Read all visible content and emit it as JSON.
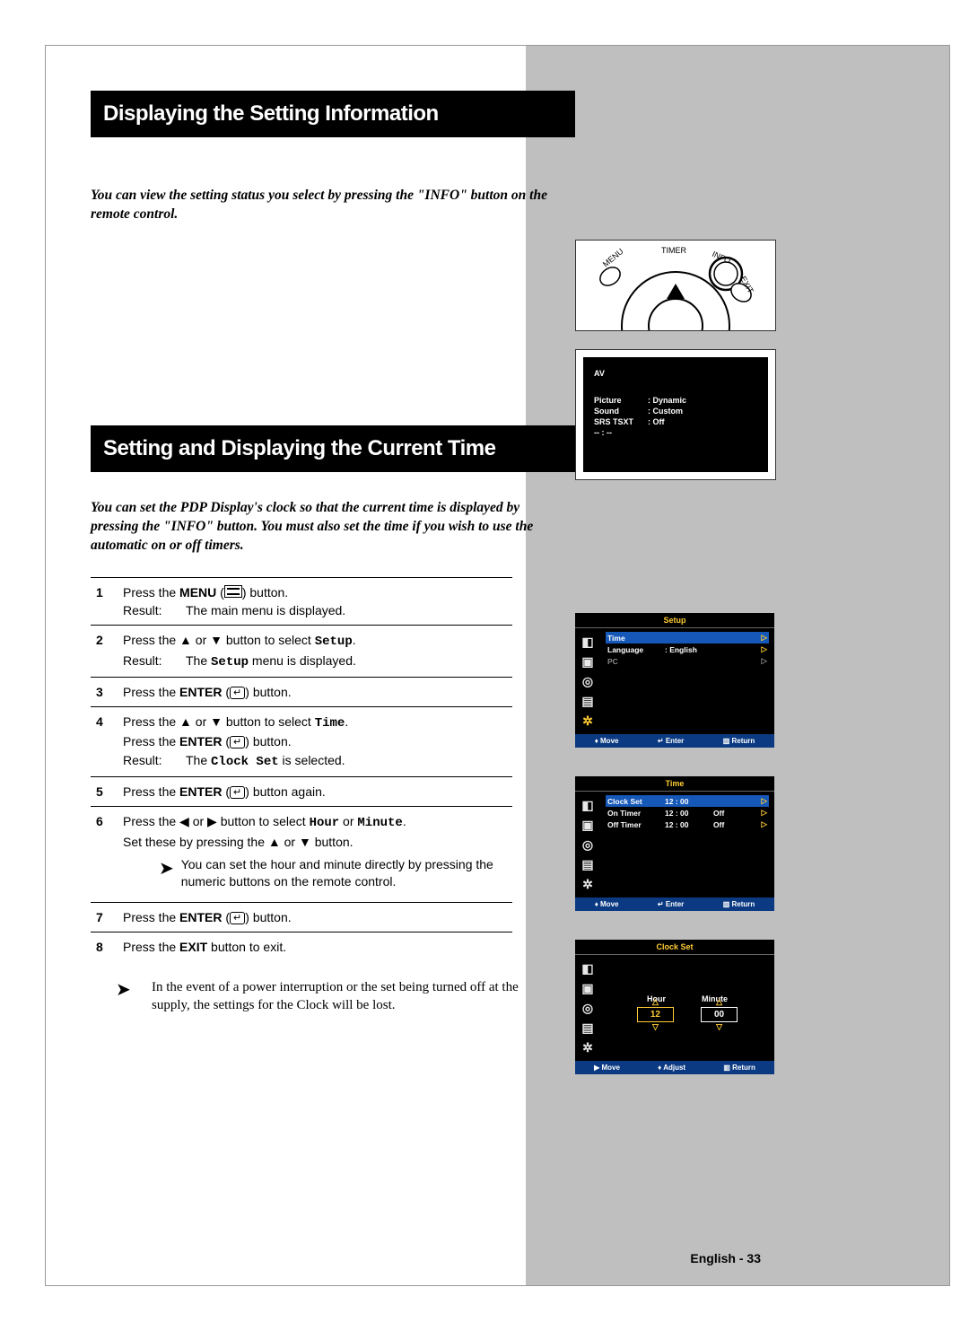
{
  "section1": {
    "title": "Displaying the Setting Information",
    "intro": "You can view the setting status you select by pressing the \"INFO\" button on the remote control."
  },
  "section2": {
    "title": "Setting and Displaying the Current Time",
    "intro": "You can set the PDP Display's clock so that the current time is displayed by pressing the \"INFO\" button. You must also set the time if you wish to use the automatic on or off timers."
  },
  "steps": {
    "1": {
      "num": "1",
      "a": "Press the ",
      "b": "MENU",
      "c": " (",
      "d": ") button.",
      "r": "Result:",
      "res": "The main menu is displayed."
    },
    "2": {
      "num": "2",
      "a": "Press the ",
      "b": " or ",
      "c": " button to select ",
      "d": "Setup",
      "e": ".",
      "r": "Result:",
      "res1": "The ",
      "res2": "Setup",
      "res3": " menu is displayed."
    },
    "3": {
      "num": "3",
      "a": "Press the ",
      "b": "ENTER",
      "c": " (",
      "d": ") button."
    },
    "4": {
      "num": "4",
      "a": "Press the ",
      "b": " or ",
      "c": " button to select ",
      "d": "Time",
      "e": ".",
      "f": "Press the ",
      "g": "ENTER",
      "h": " (",
      "i": ") button.",
      "r": "Result:",
      "res1": "The ",
      "res2": "Clock Set",
      "res3": " is selected."
    },
    "5": {
      "num": "5",
      "a": "Press the ",
      "b": "ENTER",
      "c": " (",
      "d": ") button again."
    },
    "6": {
      "num": "6",
      "a": "Press the ",
      "b": " or ",
      "c": " button to select ",
      "d": "Hour",
      "e": " or ",
      "f": "Minute",
      "g": ".",
      "h": "Set these by pressing the ",
      "i": " or ",
      "j": " button.",
      "note": "You can set the hour and minute directly by pressing the numeric buttons on the remote control."
    },
    "7": {
      "num": "7",
      "a": "Press the ",
      "b": "ENTER",
      "c": " (",
      "d": ") button."
    },
    "8": {
      "num": "8",
      "a": "Press the ",
      "b": "EXIT",
      "c": " button to exit."
    }
  },
  "footnote": "In the event of a power interruption or the set being turned off at the supply, the settings for the Clock will be lost.",
  "remote": {
    "menu": "MENU",
    "timer": "TIMER",
    "info": "INFO",
    "exit": "EXIT"
  },
  "infoPanel": {
    "mode": "AV",
    "picture_l": "Picture",
    "picture_v": ": Dynamic",
    "sound_l": "Sound",
    "sound_v": ": Custom",
    "srs_l": "SRS TSXT",
    "srs_v": ": Off",
    "time": "-- : --"
  },
  "osd1": {
    "header": "Setup",
    "rows": {
      "time": "Time",
      "lang_l": "Language",
      "lang_v": ": English",
      "pc": "PC"
    },
    "footer": {
      "move": "Move",
      "enter": "Enter",
      "return": "Return"
    }
  },
  "osd2": {
    "header": "Time",
    "rows": {
      "clock_l": "Clock Set",
      "clock_v": "12 : 00",
      "on_l": "On Timer",
      "on_v": "12 : 00",
      "on_s": "Off",
      "off_l": "Off Timer",
      "off_v": "12 : 00",
      "off_s": "Off"
    },
    "footer": {
      "move": "Move",
      "enter": "Enter",
      "return": "Return"
    }
  },
  "osd3": {
    "header": "Clock Set",
    "hour_l": "Hour",
    "min_l": "Minute",
    "hour_v": "12",
    "min_v": "00",
    "footer": {
      "move": "Move",
      "adjust": "Adjust",
      "return": "Return"
    }
  },
  "footer": "English - 33"
}
